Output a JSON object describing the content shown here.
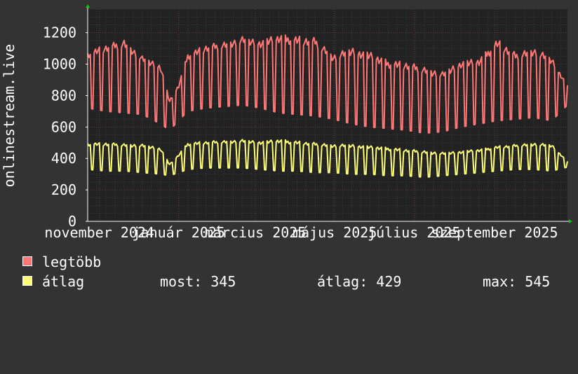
{
  "y_axis_label": "onlinestream.live",
  "colors": {
    "max_series": "#ff7777",
    "avg_series": "#ffff77",
    "background": "#333333",
    "plot": "#222222"
  },
  "legend": {
    "max": {
      "label": "legtöbb"
    },
    "avg": {
      "label": "átlag",
      "stats": {
        "now": "most: 345",
        "avg": "átlag: 429",
        "max": "max: 545"
      }
    }
  },
  "chart_data": {
    "type": "line",
    "y_ticks": [
      0,
      200,
      400,
      600,
      800,
      1000,
      1200
    ],
    "ylim": [
      0,
      1350
    ],
    "x_range": [
      "2024-10-23",
      "2025-10-27"
    ],
    "x_ticks": [
      {
        "date": "2024-11-01",
        "label": "november 2024"
      },
      {
        "date": "2025-01-01",
        "label": "január 2025"
      },
      {
        "date": "2025-03-01",
        "label": "március 2025"
      },
      {
        "date": "2025-05-01",
        "label": "május 2025"
      },
      {
        "date": "2025-07-01",
        "label": "július 2025"
      },
      {
        "date": "2025-09-01",
        "label": "szeptember 2025"
      }
    ],
    "grid": true,
    "series": [
      {
        "name": "legtöbb",
        "color": "#ff7777",
        "x": [
          "2024-10-23",
          "2024-11-06",
          "2024-11-20",
          "2024-12-04",
          "2024-12-18",
          "2024-12-25",
          "2025-01-01",
          "2025-01-08",
          "2025-01-22",
          "2025-02-05",
          "2025-02-19",
          "2025-03-05",
          "2025-03-19",
          "2025-04-02",
          "2025-04-16",
          "2025-04-30",
          "2025-05-14",
          "2025-05-28",
          "2025-06-11",
          "2025-06-25",
          "2025-07-09",
          "2025-07-23",
          "2025-08-06",
          "2025-08-20",
          "2025-09-03",
          "2025-09-17",
          "2025-10-01",
          "2025-10-15",
          "2025-10-27"
        ],
        "high": [
          1060,
          1100,
          1130,
          1030,
          980,
          760,
          860,
          1050,
          1100,
          1120,
          1150,
          1130,
          1160,
          1150,
          1140,
          1040,
          1080,
          1050,
          1000,
          990,
          960,
          930,
          1000,
          1010,
          1130,
          1050,
          1080,
          1020,
          860
        ],
        "low": [
          720,
          700,
          690,
          680,
          620,
          580,
          640,
          700,
          720,
          730,
          740,
          720,
          690,
          680,
          670,
          650,
          620,
          600,
          590,
          580,
          560,
          570,
          600,
          620,
          640,
          650,
          660,
          640,
          740
        ]
      },
      {
        "name": "átlag",
        "color": "#ffff77",
        "x": [
          "2024-10-23",
          "2024-11-06",
          "2024-11-20",
          "2024-12-04",
          "2024-12-18",
          "2024-12-25",
          "2025-01-01",
          "2025-01-08",
          "2025-01-22",
          "2025-02-05",
          "2025-02-19",
          "2025-03-05",
          "2025-03-19",
          "2025-04-02",
          "2025-04-16",
          "2025-04-30",
          "2025-05-14",
          "2025-05-28",
          "2025-06-11",
          "2025-06-25",
          "2025-07-09",
          "2025-07-23",
          "2025-08-06",
          "2025-08-20",
          "2025-09-03",
          "2025-09-17",
          "2025-10-01",
          "2025-10-15",
          "2025-10-27"
        ],
        "high": [
          490,
          490,
          485,
          480,
          460,
          360,
          420,
          490,
          500,
          505,
          510,
          500,
          510,
          500,
          490,
          480,
          480,
          470,
          460,
          450,
          440,
          430,
          440,
          450,
          470,
          480,
          490,
          480,
          380
        ],
        "low": [
          330,
          320,
          320,
          310,
          300,
          290,
          310,
          330,
          340,
          340,
          340,
          330,
          320,
          320,
          310,
          310,
          300,
          300,
          290,
          290,
          280,
          290,
          300,
          310,
          320,
          330,
          330,
          320,
          345
        ]
      }
    ]
  }
}
